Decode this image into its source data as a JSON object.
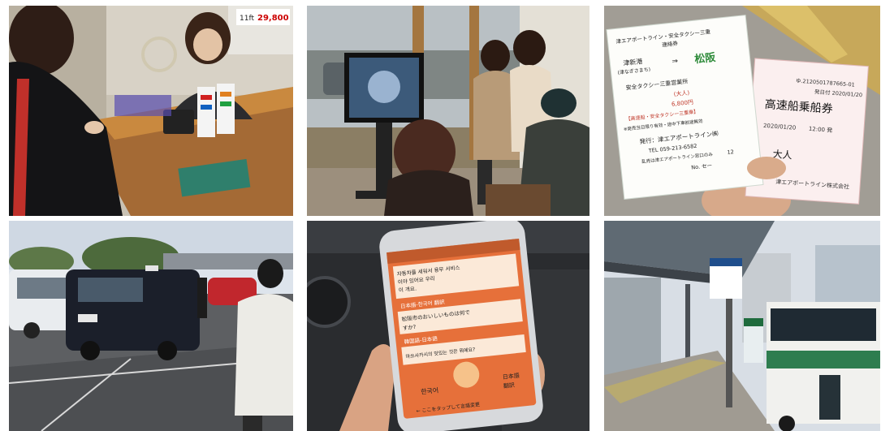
{
  "photos": [
    {
      "name": "ticket-counter-photo"
    },
    {
      "name": "waiting-room-photo"
    },
    {
      "name": "tickets-photo"
    },
    {
      "name": "taxi-stand-photo"
    },
    {
      "name": "translation-app-photo"
    },
    {
      "name": "bus-stop-photo"
    }
  ],
  "counter": {
    "price_sign": "29,800",
    "price_prefix": "11ft"
  },
  "tickets": {
    "left_header": "津エアポートライン・安全タクシー三重",
    "left_header2": "連絡券",
    "route_from": "津新港",
    "route_from_sub": "(津なぎさまち)",
    "route_arrow": "⇒",
    "route_to": "松阪",
    "operator_line": "安全タクシー三重営業所",
    "adult": "(大人)",
    "price": "6,800円",
    "note1": "【高速船・安全タクシー三重乗】",
    "note2": "※発売当日限り有効・途中下車前途無効",
    "issuer": "発行：津エアポートライン㈱",
    "tel": "TEL 059-213-6582",
    "issuer_sub": "乱売は津エアポートライン窓口のみ",
    "serial_label": "No. セー",
    "serial_num": "12",
    "right_code": "ゆ.2120501787665-01",
    "right_valid": "発日付 2020/01/20",
    "right_title": "高速船乗船券",
    "right_date": "2020/01/20",
    "right_time": "12:00 発",
    "right_adult": "大人",
    "right_company": "津エアポートライン株式会社"
  },
  "app": {
    "line1": "자동차를 세워서 용무 서비스",
    "line1b": "이야 있어요 우리",
    "line1c": "이 개요.",
    "section2": "日本語-한국어 翻訳",
    "line2": "松阪市のおいしいものは何で",
    "line2b": "すか?",
    "section3": "韓国語-日本語",
    "line3": "마쓰사카시의 맛있는 것은 뭐예요?",
    "lang_left": "한국어",
    "lang_right1": "日本語",
    "lang_right2": "翻訳",
    "bottom": "← ここをタップして言語変更"
  },
  "colors": {
    "app_orange": "#e6703a",
    "ticket_green": "#2e8b3a",
    "ticket_red": "#c0392b",
    "bus_green": "#2e7d4f"
  }
}
